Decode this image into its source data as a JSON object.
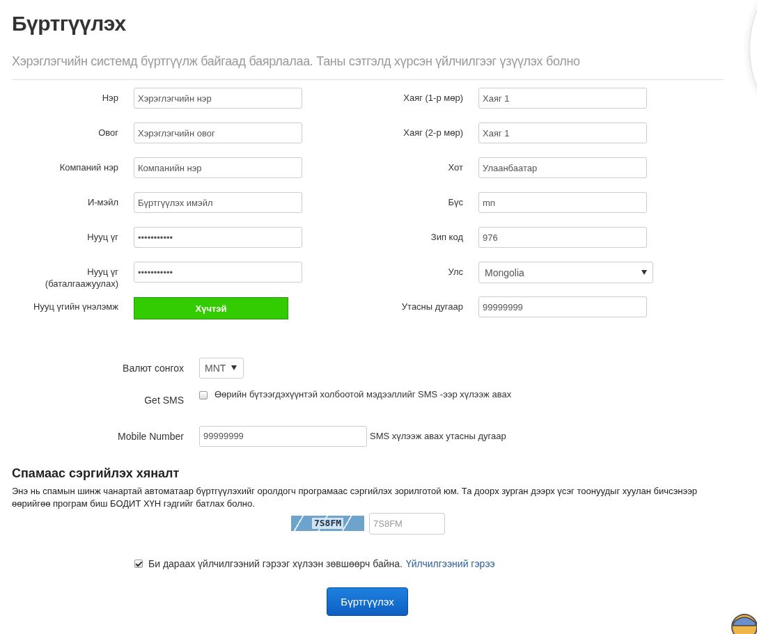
{
  "page": {
    "title": "Бүртгүүлэх",
    "subtitle": "Хэрэглэгчийн системд бүртгүүлж байгаад баярлалаа. Таны сэтгэлд хүрсэн үйлчилгээг үзүүлэх болно"
  },
  "left_fields": [
    {
      "kind": "text",
      "label": "Нэр",
      "value": "Хэрэглэгчийн нэр"
    },
    {
      "kind": "text",
      "label": "Овог",
      "value": "Хэрэглэгчийн овог"
    },
    {
      "kind": "text",
      "label": "Компаний нэр",
      "value": "Компанийн нэр"
    },
    {
      "kind": "text",
      "label": "И-мэйл",
      "value": "Бүртгүүлэх имэйл"
    },
    {
      "kind": "text",
      "label": "Нууц үг",
      "value": "•••••••••••"
    },
    {
      "kind": "text",
      "label": "Нууц үг (баталгаажуулах)",
      "value": "•••••••••••"
    },
    {
      "kind": "strength",
      "label": "Нууц үгийн үнэлэмж",
      "value": "Хүчтэй",
      "level": 1
    }
  ],
  "right_fields": [
    {
      "kind": "text",
      "label": "Хаяг (1-р мөр)",
      "value": "Хаяг 1"
    },
    {
      "kind": "text",
      "label": "Хаяг (2-р мөр)",
      "value": "Хаяг 1"
    },
    {
      "kind": "text",
      "label": "Хот",
      "value": "Улаанбаатар"
    },
    {
      "kind": "text",
      "label": "Бүс",
      "value": "mn"
    },
    {
      "kind": "text",
      "label": "Зип код",
      "value": "976"
    },
    {
      "kind": "select",
      "label": "Улс",
      "value": "Mongolia"
    },
    {
      "kind": "text",
      "label": "Утасны дугаар",
      "value": "99999999"
    }
  ],
  "currency": {
    "label": "Валют сонгох",
    "value": "MNT"
  },
  "sms": {
    "label": "Get SMS",
    "checked": false,
    "text": "Өөрийн бүтээгдэхүүнтэй холбоотой мэдээллийг SMS -ээр хүлээж авах"
  },
  "mobile": {
    "label": "Mobile Number",
    "value": "99999999",
    "hint": "SMS хүлээж авах утасны дугаар"
  },
  "spam": {
    "heading": "Спамаас сэргийлэх хяналт",
    "text": "Энэ нь спамын шинж чанартай автоматаар бүртгүүлэхийг оролдогч програмаас сэргийлэх зорилготой юм. Та доорх зурган дээрх үсэг тоонуудыг хуулан бичсэнээр өөрийгөө програм биш БОДИТ ХҮН гэдгийг батлах болно.",
    "captcha": "7S8FM",
    "placeholder": "7S8FM"
  },
  "agreement": {
    "checked": true,
    "text": "Би дараах үйлчилгээний гэрээг хүлээн зөвшөөрч байна.",
    "link": "Үйлчилгээний гэрээ"
  },
  "submit": "Бүртгүүлэх"
}
